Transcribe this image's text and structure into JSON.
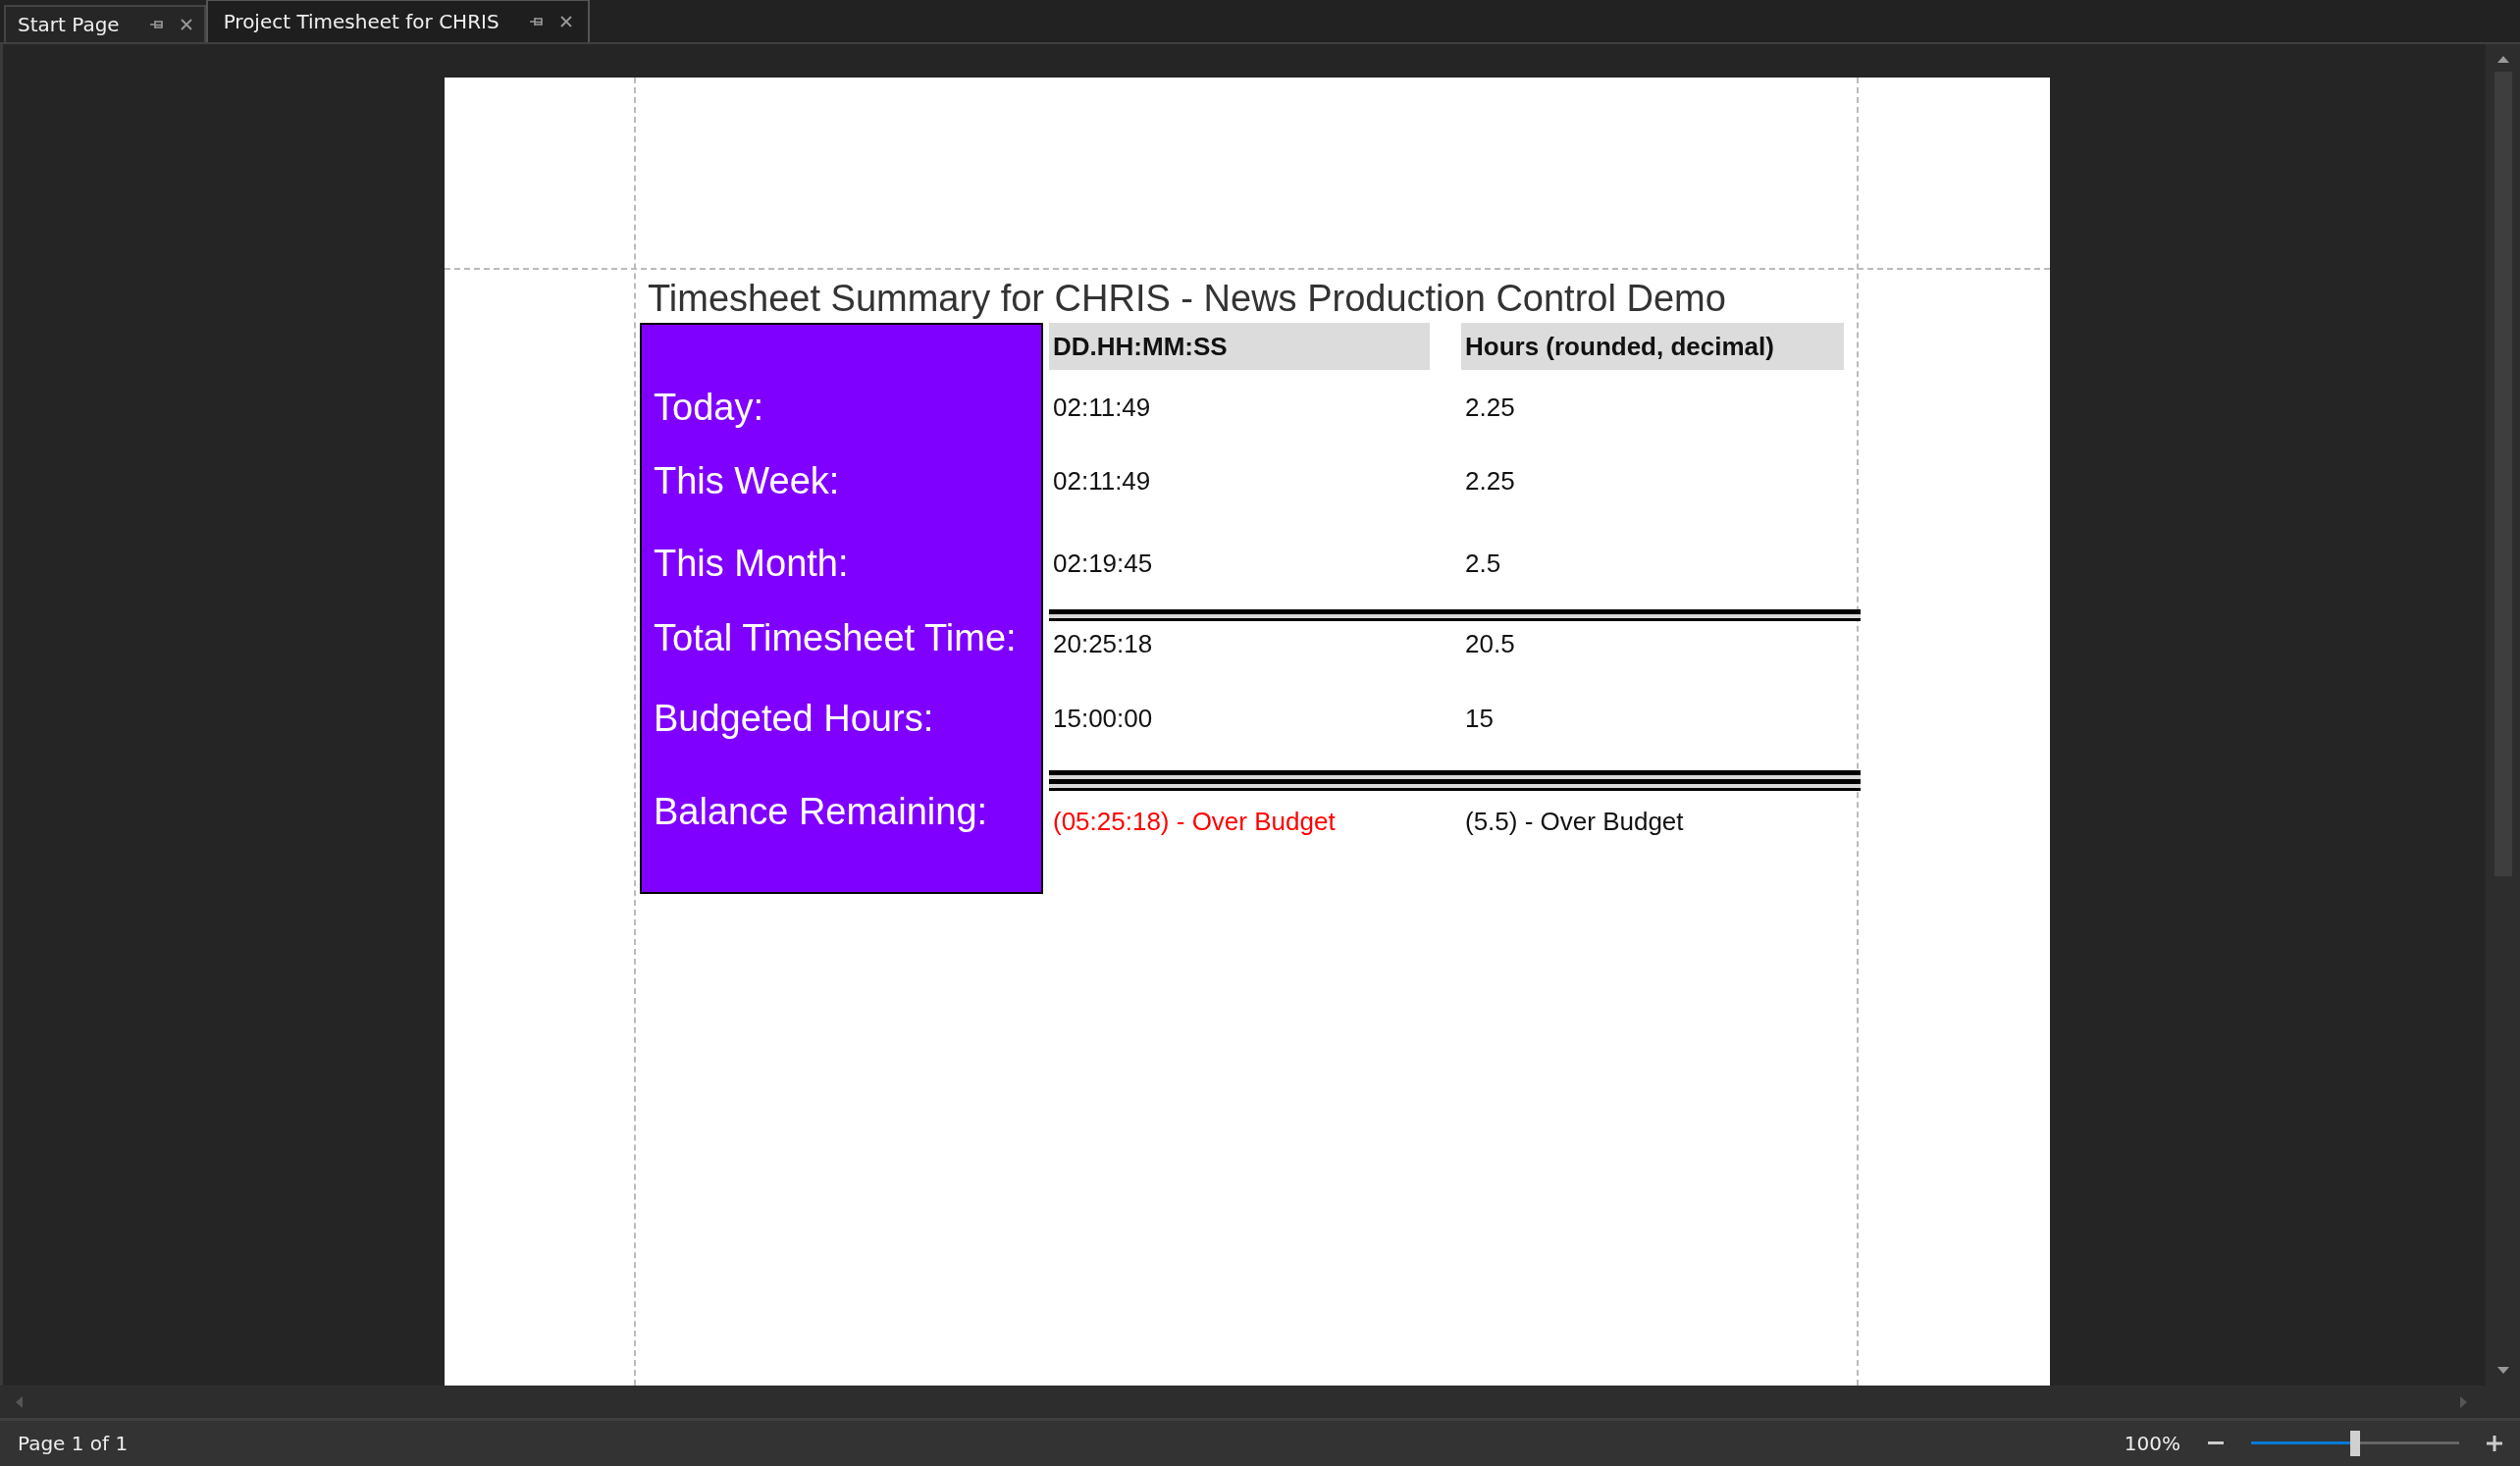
{
  "tabs": [
    {
      "label": "Start Page",
      "selected": false
    },
    {
      "label": "Project Timesheet for CHRIS",
      "selected": true
    }
  ],
  "report": {
    "title": "Timesheet Summary for CHRIS - News Production Control Demo",
    "columns": [
      "DD.HH:MM:SS",
      "Hours (rounded, decimal)"
    ],
    "rows": [
      {
        "label": "Today:",
        "time": "02:11:49",
        "hours": "2.25",
        "kind": "plain",
        "over_budget": false
      },
      {
        "label": "This Week:",
        "time": "02:11:49",
        "hours": "2.25",
        "kind": "plain",
        "over_budget": false
      },
      {
        "label": "This Month:",
        "time": "02:19:45",
        "hours": "2.5",
        "kind": "plain",
        "over_budget": false
      },
      {
        "label": "Total Timesheet Time:",
        "time": "20:25:18",
        "hours": "20.5",
        "kind": "total",
        "over_budget": false
      },
      {
        "label": "Budgeted Hours:",
        "time": "15:00:00",
        "hours": "15",
        "kind": "plain",
        "over_budget": false
      },
      {
        "label": "Balance Remaining:",
        "time": "(05:25:18) - Over Budget",
        "hours": "(5.5) - Over Budget",
        "kind": "balance",
        "over_budget": true
      }
    ]
  },
  "status_bar": {
    "page": "Page 1 of 1",
    "zoom": "100%",
    "zoom_slider": {
      "level": 0.5
    }
  }
}
